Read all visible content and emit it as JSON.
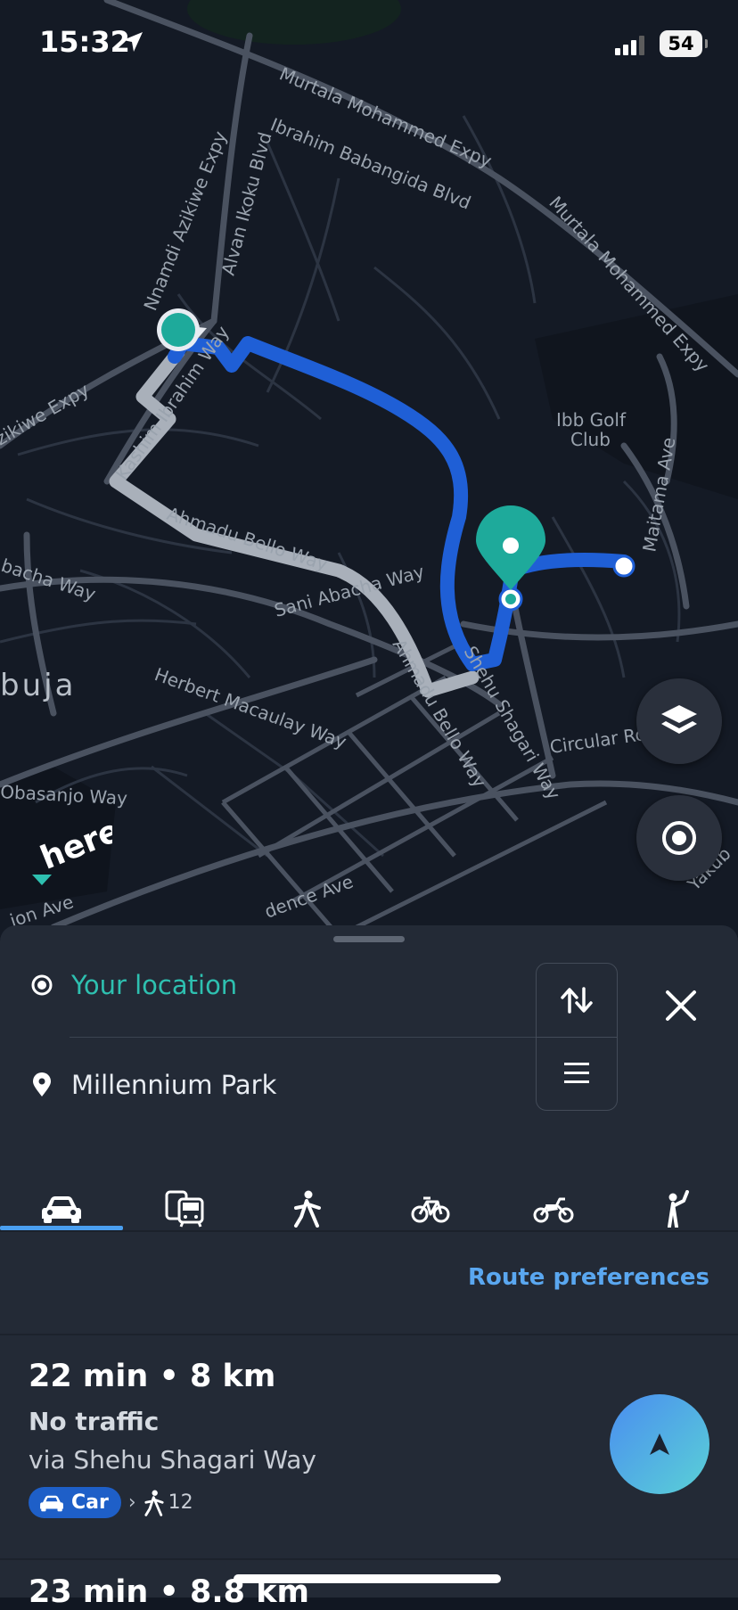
{
  "status_bar": {
    "time": "15:32",
    "battery": "54"
  },
  "map": {
    "labels": {
      "murtala_1": "Murtala Mohammed Expy",
      "murtala_2": "Murtala Mohammed Expy",
      "ibrahim_babangida": "Ibrahim Babangida Blvd",
      "nnamdi": "Nnamdi Azikiwe Expy",
      "alvan": "Alvan Ikoku Blvd",
      "azikiwe_expy": "zikiwe Expy",
      "kashim": "Kashim Ibrahim Way",
      "ahmadu_1": "Ahmadu Bello Way",
      "ahmadu_2": "Ahmadu Bello Way",
      "abacha_left": "bacha Way",
      "sani_abacha": "Sani Abacha Way",
      "abuja": "buja",
      "herbert": "Herbert Macaulay Way",
      "obasanjo": "Obasanjo Way",
      "shehu": "Shehu Shagari Way",
      "circular": "Circular Ro",
      "maitama": "Maitama Ave",
      "golf": "Ibb Golf",
      "golf2": "Club",
      "independence": "dence Ave",
      "ion_ave": "ion Ave",
      "yakub": "Yakub",
      "logo": "here"
    }
  },
  "sheet": {
    "origin": "Your location",
    "destination": "Millennium Park",
    "route_preferences": "Route preferences",
    "routes": [
      {
        "summary": "22 min • 8 km",
        "traffic": "No traffic",
        "via": "via Shehu Shagari Way",
        "mode_chip": "Car",
        "walk_minutes": "12"
      },
      {
        "summary": "23 min • 8.8 km"
      }
    ]
  },
  "colors": {
    "route": "#1f5fd6",
    "accent": "#2ec0b0",
    "link": "#5aa7f0"
  }
}
